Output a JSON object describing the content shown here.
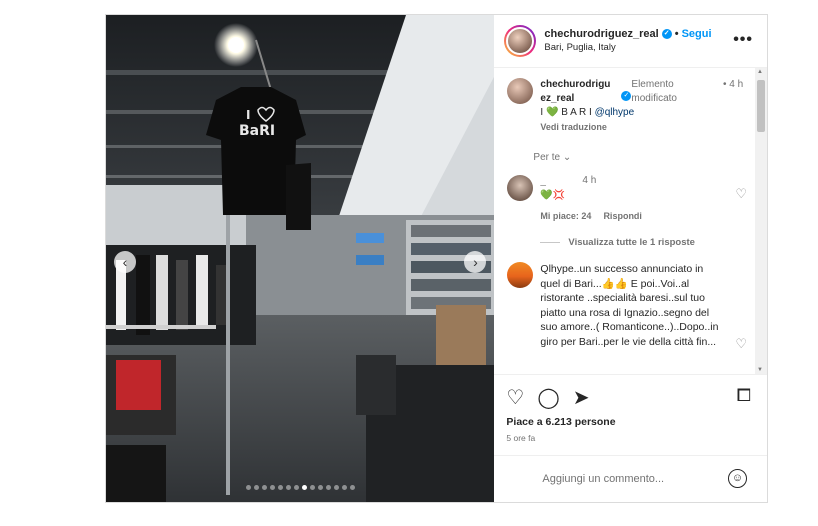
{
  "post": {
    "carousel": {
      "dot_count": 14,
      "active_index": 7
    },
    "header": {
      "username": "chechurodriguez_real",
      "separator": "•",
      "follow_label": "Segui",
      "location": "Bari, Puglia, Italy",
      "more_label": "•••"
    },
    "caption": {
      "username_line1": "chechurodrigu",
      "username_line2": "ez_real",
      "edited_line1": "Elemento",
      "edited_line2": "modificato",
      "time_dot": "•",
      "time": "4 h",
      "text_start": "I",
      "text_heart": "💚",
      "text_end": "B A R I",
      "mention": "@qlhype",
      "translate_label": "Vedi traduzione"
    },
    "per_te_label": "Per te",
    "comments": [
      {
        "username": "_",
        "time": "4 h",
        "text": "💚💢",
        "likes_label": "Mi piace: 24",
        "reply_label": "Rispondi",
        "view_replies_label": "Visualizza tutte le 1 risposte"
      },
      {
        "text": "Qlhype..un successo annunciato in quel di Bari...👍👍 E poi..Voi..al ristorante ..specialità baresi..sul tuo piatto una rosa di Ignazio..segno del suo amore..( Romanticone..)..Dopo..in giro per Bari..per le vie della città fin..."
      }
    ],
    "actions": {
      "like_icon": "♡",
      "comment_icon": "◯",
      "share_icon": "➤",
      "save_icon": "⧠"
    },
    "likes_text": "Piace a 6.213 persone",
    "time_ago": "5 ore fa",
    "add_comment_placeholder": "Aggiungi un commento...",
    "emoji_icon": "☺"
  }
}
